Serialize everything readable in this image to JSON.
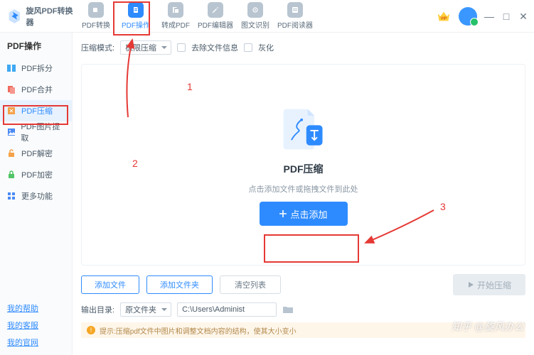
{
  "app_name": "旋风PDF转换器",
  "tabs": [
    "PDF转换",
    "PDF操作",
    "转成PDF",
    "PDF编辑器",
    "图文识别",
    "PDF阅读器"
  ],
  "side_header": "PDF操作",
  "side_items": [
    "PDF拆分",
    "PDF合并",
    "PDF压缩",
    "PDF图片提取",
    "PDF解密",
    "PDF加密",
    "更多功能"
  ],
  "footer_links": [
    "我的帮助",
    "我的客服",
    "我的官网"
  ],
  "opt_label": "压缩模式:",
  "opt_value": "极限压缩",
  "cb1": "去除文件信息",
  "cb2": "灰化",
  "drop_title": "PDF压缩",
  "drop_sub": "点击添加文件或拖拽文件到此处",
  "add_btn": "点击添加",
  "btn_addfile": "添加文件",
  "btn_addfolder": "添加文件夹",
  "btn_clear": "清空列表",
  "btn_start": "开始压缩",
  "out_label": "输出目录:",
  "out_sel": "原文件夹",
  "out_path": "C:\\Users\\Administ",
  "tip": "提示:压缩pdf文件中图片和调整文档内容的结构，使其大小变小",
  "anno": {
    "n1": "1",
    "n2": "2",
    "n3": "3"
  },
  "watermark": "知乎 @旋风办公"
}
